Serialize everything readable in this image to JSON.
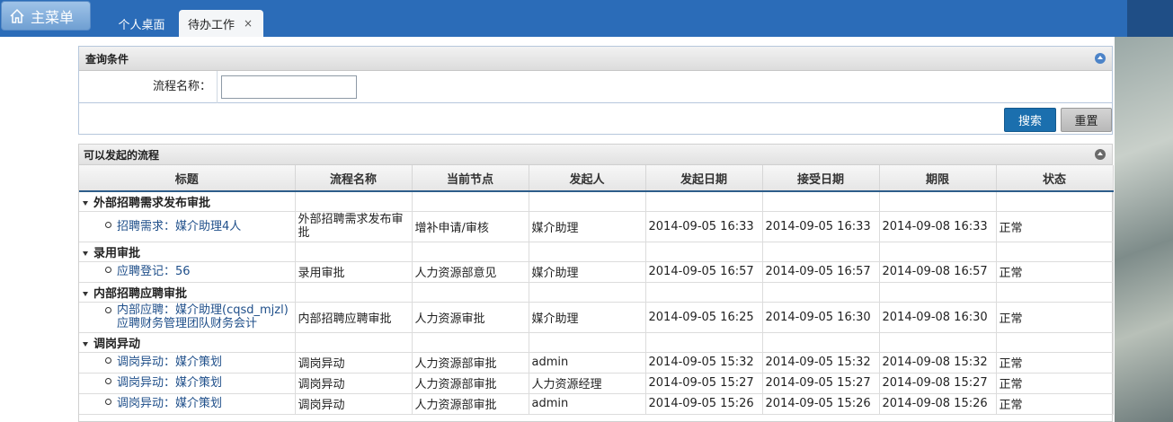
{
  "topbar": {
    "menu_label": "主菜单",
    "tabs": [
      {
        "label": "个人桌面"
      },
      {
        "label": "待办工作",
        "close": "×"
      }
    ]
  },
  "query": {
    "header": "查询条件",
    "field_label": "流程名称：",
    "field_value": "",
    "field_placeholder": "",
    "search_label": "搜索",
    "reset_label": "重置"
  },
  "flows": {
    "header": "可以发起的流程",
    "columns": [
      "标题",
      "流程名称",
      "当前节点",
      "发起人",
      "发起日期",
      "接受日期",
      "期限",
      "状态"
    ],
    "groups": [
      {
        "title": "外部招聘需求发布审批",
        "rows": [
          {
            "title": "招聘需求：媒介助理4人",
            "process": "外部招聘需求发布审批",
            "node": "增补申请/审核",
            "initiator": "媒介助理",
            "start": "2014-09-05 16:33",
            "accept": "2014-09-05 16:33",
            "deadline": "2014-09-08 16:33",
            "status": "正常"
          }
        ]
      },
      {
        "title": "录用审批",
        "rows": [
          {
            "title": "应聘登记：56",
            "process": "录用审批",
            "node": "人力资源部意见",
            "initiator": "媒介助理",
            "start": "2014-09-05 16:57",
            "accept": "2014-09-05 16:57",
            "deadline": "2014-09-08 16:57",
            "status": "正常"
          }
        ]
      },
      {
        "title": "内部招聘应聘审批",
        "rows": [
          {
            "title": "内部应聘：媒介助理(cqsd_mjzl)应聘财务管理团队财务会计",
            "process": "内部招聘应聘审批",
            "node": "人力资源审批",
            "initiator": "媒介助理",
            "start": "2014-09-05 16:25",
            "accept": "2014-09-05 16:30",
            "deadline": "2014-09-08 16:30",
            "status": "正常"
          }
        ]
      },
      {
        "title": "调岗异动",
        "rows": [
          {
            "title": "调岗异动：媒介策划",
            "process": "调岗异动",
            "node": "人力资源部审批",
            "initiator": "admin",
            "start": "2014-09-05 15:32",
            "accept": "2014-09-05 15:32",
            "deadline": "2014-09-08 15:32",
            "status": "正常"
          },
          {
            "title": "调岗异动：媒介策划",
            "process": "调岗异动",
            "node": "人力资源部审批",
            "initiator": "人力资源经理",
            "start": "2014-09-05 15:27",
            "accept": "2014-09-05 15:27",
            "deadline": "2014-09-08 15:27",
            "status": "正常"
          },
          {
            "title": "调岗异动：媒介策划",
            "process": "调岗异动",
            "node": "人力资源部审批",
            "initiator": "admin",
            "start": "2014-09-05 15:26",
            "accept": "2014-09-05 15:26",
            "deadline": "2014-09-08 15:26",
            "status": "正常"
          }
        ]
      }
    ]
  }
}
